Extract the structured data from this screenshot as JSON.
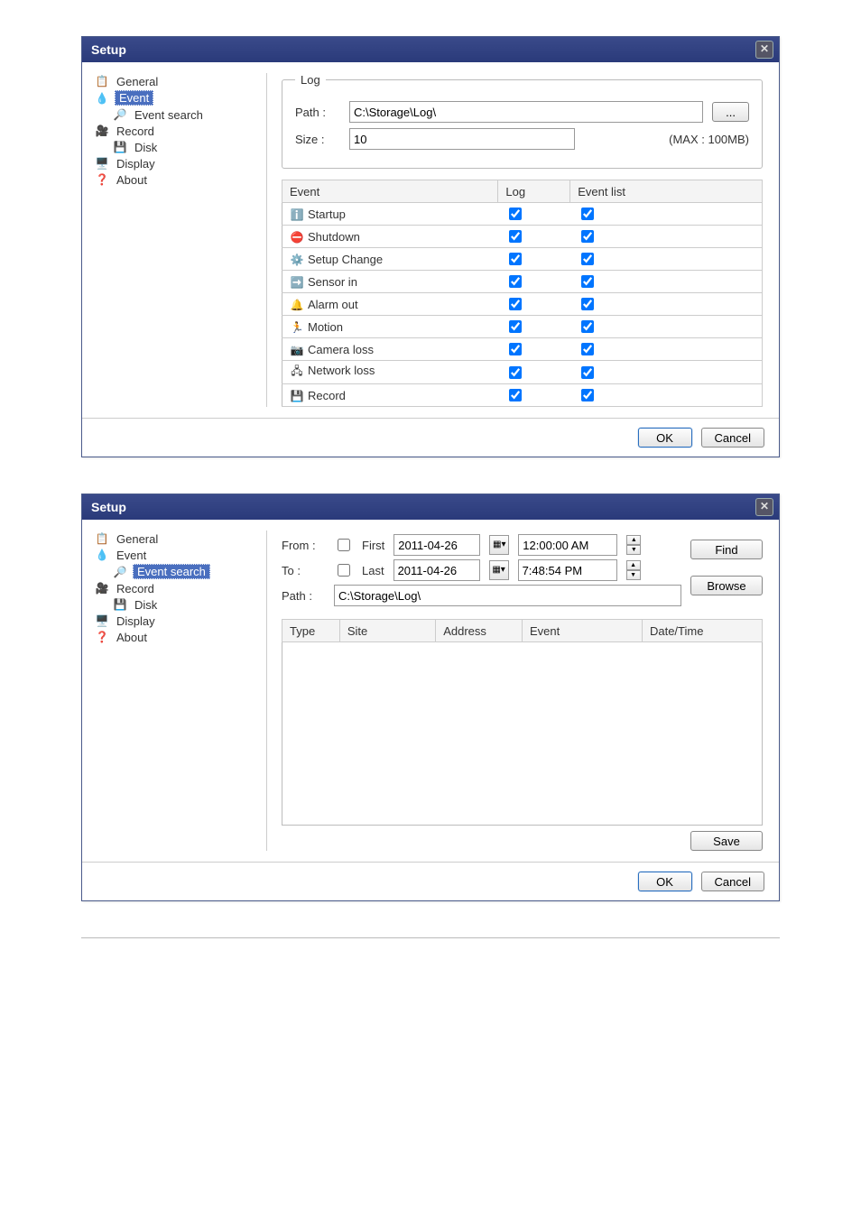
{
  "dialog1": {
    "title": "Setup",
    "sidebar": {
      "general": "General",
      "event": "Event",
      "event_search": "Event search",
      "record": "Record",
      "disk": "Disk",
      "display": "Display",
      "about": "About"
    },
    "log": {
      "legend": "Log",
      "path_label": "Path :",
      "path_value": "C:\\Storage\\Log\\",
      "browse_btn": "...",
      "size_label": "Size :",
      "size_value": "10",
      "max_hint": "(MAX : 100MB)"
    },
    "events_table": {
      "headers": {
        "event": "Event",
        "log": "Log",
        "eventlist": "Event list"
      },
      "rows": [
        {
          "icon": "ℹ️",
          "name": "Startup",
          "log": true,
          "eventlist": true
        },
        {
          "icon": "⛔",
          "name": "Shutdown",
          "log": true,
          "eventlist": true
        },
        {
          "icon": "⚙️",
          "name": "Setup Change",
          "log": true,
          "eventlist": true
        },
        {
          "icon": "➡️",
          "name": "Sensor in",
          "log": true,
          "eventlist": true
        },
        {
          "icon": "🔔",
          "name": "Alarm out",
          "log": true,
          "eventlist": true
        },
        {
          "icon": "🏃",
          "name": "Motion",
          "log": true,
          "eventlist": true
        },
        {
          "icon": "📷",
          "name": "Camera loss",
          "log": true,
          "eventlist": true
        },
        {
          "icon": "🖧",
          "name": "Network loss",
          "log": true,
          "eventlist": true
        },
        {
          "icon": "💾",
          "name": "Record",
          "log": true,
          "eventlist": true
        }
      ]
    },
    "buttons": {
      "ok": "OK",
      "cancel": "Cancel"
    }
  },
  "dialog2": {
    "title": "Setup",
    "sidebar": {
      "general": "General",
      "event": "Event",
      "event_search": "Event search",
      "record": "Record",
      "disk": "Disk",
      "display": "Display",
      "about": "About"
    },
    "search": {
      "from_label": "From :",
      "first_label": "First",
      "from_date": "2011-04-26",
      "from_time": "12:00:00 AM",
      "to_label": "To :",
      "last_label": "Last",
      "to_date": "2011-04-26",
      "to_time": "7:48:54 PM",
      "path_label": "Path :",
      "path_value": "C:\\Storage\\Log\\",
      "find_btn": "Find",
      "browse_btn": "Browse"
    },
    "results": {
      "headers": {
        "type": "Type",
        "site": "Site",
        "address": "Address",
        "event": "Event",
        "datetime": "Date/Time"
      }
    },
    "save_btn": "Save",
    "buttons": {
      "ok": "OK",
      "cancel": "Cancel"
    }
  }
}
